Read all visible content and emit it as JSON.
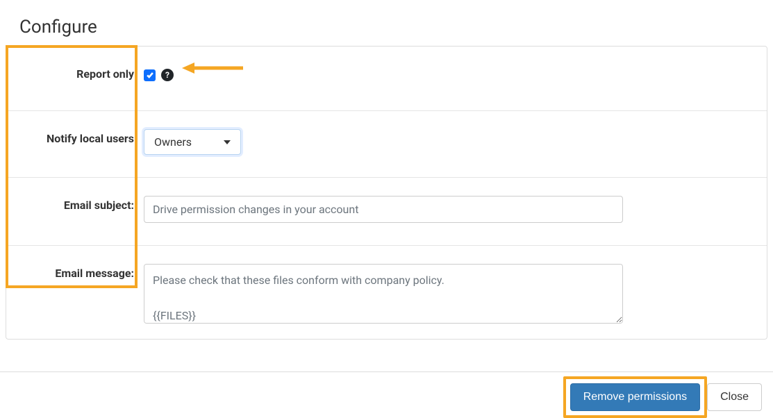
{
  "page_title": "Configure",
  "annotations": {
    "label_highlight_color": "#f5a623",
    "button_highlight_color": "#f5a623",
    "arrow_color": "#f5a623"
  },
  "form": {
    "report_only": {
      "label": "Report only",
      "checked": true
    },
    "notify_local_users": {
      "label": "Notify local users",
      "selected": "Owners"
    },
    "email_subject": {
      "label": "Email subject:",
      "value": "Drive permission changes in your account"
    },
    "email_message": {
      "label": "Email message:",
      "value": "Please check that these files conform with company policy.\n\n{{FILES}}"
    }
  },
  "footer": {
    "primary_label": "Remove permissions",
    "close_label": "Close"
  }
}
